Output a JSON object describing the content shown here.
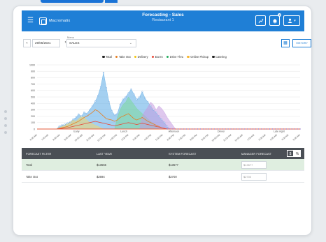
{
  "app": {
    "brand": "Macromatix",
    "title": "Forecasting - Sales",
    "subtitle": "Restaurant 1",
    "notification_count": "2"
  },
  "toolbar": {
    "menu_label": "Menu",
    "date": "29/06/2021",
    "menu_value": "SALES",
    "history_label": "HISTORY"
  },
  "icons": {
    "menu": "hamburger-icon",
    "prev": "chevron-left-icon",
    "next": "chevron-right-icon",
    "chart": "chart-icon",
    "bell": "bell-icon",
    "user": "user-icon",
    "grid": "grid-icon"
  },
  "chart_data": {
    "type": "area",
    "legend": [
      {
        "name": "Total",
        "color": "#222222"
      },
      {
        "name": "Take Out",
        "color": "#e67e22"
      },
      {
        "name": "Delivery",
        "color": "#f1c40f"
      },
      {
        "name": "Eat In",
        "color": "#e74c3c"
      },
      {
        "name": "Drive Thru",
        "color": "#27ae60"
      },
      {
        "name": "Online Pickup",
        "color": "#f7b733"
      },
      {
        "name": "Catering",
        "color": "#222222"
      }
    ],
    "yticks": [
      "1000",
      "900",
      "800",
      "700",
      "600",
      "500",
      "400",
      "300",
      "200",
      "100",
      "0"
    ],
    "ylim": [
      0,
      1000
    ],
    "xticks": [
      "6:00 AM",
      "7:00 AM",
      "8:00 AM",
      "9:00 AM",
      "10:00 AM",
      "11:00 AM",
      "12:00 PM",
      "1:00 PM",
      "2:00 PM",
      "3:00 PM",
      "4:00 PM",
      "5:00 PM",
      "6:00 PM",
      "7:00 PM",
      "8:00 PM",
      "9:00 PM",
      "10:00 PM",
      "11:00 PM",
      "12:00 AM",
      "1:00 AM",
      "2:00 AM",
      "3:00 AM",
      "4:00 AM",
      "5:00 AM"
    ],
    "dayparts": [
      "Early",
      "Lunch",
      "Afternoon",
      "Dinner",
      "Late night"
    ],
    "series": [
      {
        "name": "Total",
        "color": "#5aa9e6",
        "values": [
          0,
          0,
          0,
          0,
          0,
          0,
          0,
          0,
          40,
          60,
          70,
          90,
          110,
          150,
          180,
          230,
          200,
          260,
          240,
          300,
          360,
          430,
          520,
          660,
          880,
          640,
          420,
          280,
          220,
          240,
          380,
          460,
          500,
          560,
          620,
          540,
          460,
          500,
          580,
          480,
          420,
          360,
          300,
          260,
          200,
          150,
          100,
          40,
          0,
          0,
          0,
          0,
          0,
          0,
          0,
          0,
          0,
          0,
          0,
          0,
          0,
          0,
          0,
          0,
          0,
          0,
          0,
          0,
          0,
          0,
          0,
          0,
          0,
          0,
          0,
          0,
          0,
          0,
          0,
          0,
          0,
          0,
          0,
          0,
          0,
          0,
          0,
          0,
          0,
          0,
          0,
          0,
          0,
          0,
          0,
          0
        ]
      },
      {
        "name": "Drive Thru",
        "color": "#7bd89b",
        "values": [
          0,
          0,
          0,
          0,
          0,
          0,
          0,
          0,
          0,
          0,
          0,
          0,
          0,
          0,
          0,
          0,
          0,
          0,
          0,
          0,
          0,
          0,
          0,
          0,
          0,
          0,
          0,
          0,
          0,
          180,
          300,
          380,
          420,
          500,
          440,
          380,
          320,
          280,
          240,
          200,
          160,
          120,
          80,
          40,
          0,
          0,
          0,
          0,
          0,
          0,
          0,
          0,
          0,
          0,
          0,
          0,
          0,
          0,
          0,
          0,
          0,
          0,
          0,
          0,
          0,
          0,
          0,
          0,
          0,
          0,
          0,
          0,
          0,
          0,
          0,
          0,
          0,
          0,
          0,
          0,
          0,
          0,
          0,
          0,
          0,
          0,
          0,
          0,
          0,
          0,
          0,
          0,
          0,
          0,
          0,
          0
        ]
      },
      {
        "name": "Catering",
        "color": "#c49be0",
        "values": [
          0,
          0,
          0,
          0,
          0,
          0,
          0,
          0,
          0,
          0,
          0,
          0,
          0,
          0,
          0,
          0,
          0,
          0,
          0,
          0,
          0,
          0,
          0,
          0,
          0,
          0,
          0,
          0,
          0,
          0,
          0,
          0,
          0,
          0,
          0,
          0,
          0,
          0,
          200,
          280,
          340,
          420,
          380,
          300,
          360,
          320,
          260,
          180,
          120,
          60,
          0,
          0,
          0,
          0,
          0,
          0,
          0,
          0,
          0,
          0,
          0,
          0,
          0,
          0,
          0,
          0,
          0,
          0,
          0,
          0,
          0,
          0,
          0,
          0,
          0,
          0,
          0,
          0,
          0,
          0,
          0,
          0,
          0,
          0,
          0,
          0,
          0,
          0,
          0,
          0,
          0,
          0,
          0,
          0,
          0,
          0
        ]
      },
      {
        "name": "Delivery",
        "color": "#f3d56b",
        "values": [
          0,
          0,
          0,
          0,
          0,
          0,
          0,
          0,
          20,
          40,
          60,
          80,
          100,
          140,
          120,
          160,
          200,
          180,
          140,
          100,
          80,
          60,
          40,
          20,
          0,
          0,
          0,
          0,
          0,
          0,
          0,
          0,
          0,
          0,
          0,
          0,
          0,
          0,
          0,
          0,
          0,
          0,
          0,
          0,
          0,
          0,
          0,
          0,
          0,
          0,
          0,
          0,
          0,
          0,
          0,
          0,
          0,
          0,
          0,
          0,
          0,
          0,
          0,
          0,
          0,
          0,
          0,
          0,
          0,
          0,
          0,
          0,
          0,
          0,
          0,
          0,
          0,
          0,
          0,
          0,
          0,
          0,
          0,
          0,
          0,
          0,
          0,
          0,
          0,
          0,
          0,
          0,
          0,
          0,
          0,
          0
        ]
      },
      {
        "name": "Take Out",
        "color": "#e67e22",
        "values": [
          0,
          0,
          0,
          0,
          0,
          0,
          0,
          0,
          10,
          20,
          30,
          40,
          60,
          80,
          100,
          120,
          150,
          180,
          200,
          230,
          260,
          300,
          280,
          240,
          200,
          160,
          150,
          140,
          120,
          140,
          180,
          200,
          220,
          240,
          200,
          160,
          140,
          160,
          180,
          150,
          120,
          100,
          80,
          60,
          40,
          20,
          10,
          0,
          0,
          0,
          0,
          0,
          0,
          0,
          0,
          0,
          0,
          0,
          0,
          0,
          0,
          0,
          0,
          0,
          0,
          0,
          0,
          0,
          0,
          0,
          0,
          0,
          0,
          0,
          0,
          0,
          0,
          0,
          0,
          0,
          0,
          0,
          0,
          0,
          0,
          0,
          0,
          0,
          0,
          0,
          0,
          0,
          0,
          0,
          0,
          0
        ]
      },
      {
        "name": "Eat In",
        "color": "#e74c3c",
        "values": [
          0,
          0,
          0,
          0,
          0,
          0,
          0,
          0,
          5,
          10,
          15,
          20,
          30,
          40,
          50,
          60,
          70,
          80,
          90,
          100,
          110,
          120,
          110,
          100,
          90,
          80,
          70,
          60,
          50,
          60,
          70,
          80,
          90,
          100,
          90,
          80,
          70,
          80,
          90,
          80,
          70,
          60,
          50,
          40,
          30,
          20,
          10,
          0,
          0,
          0,
          0,
          0,
          0,
          0,
          0,
          0,
          0,
          0,
          0,
          0,
          0,
          0,
          0,
          0,
          0,
          0,
          0,
          0,
          0,
          0,
          0,
          0,
          0,
          0,
          0,
          0,
          0,
          0,
          0,
          0,
          0,
          0,
          0,
          0,
          0,
          0,
          0,
          0,
          0,
          0,
          0,
          0,
          0,
          0,
          0,
          0
        ]
      }
    ]
  },
  "table": {
    "headers": [
      "FORECAST FILTER",
      "LAST YEAR",
      "SYSTEM FORECAST",
      "MANAGER FORECAST"
    ],
    "toggle": [
      "$",
      "%"
    ],
    "rows": [
      {
        "filter": "Total",
        "last_year": "$13555",
        "system": "$13577",
        "manager_placeholder": "$13577"
      },
      {
        "filter": "Take Out",
        "last_year": "$2694",
        "system": "$2700",
        "manager_placeholder": "$2700"
      }
    ]
  }
}
